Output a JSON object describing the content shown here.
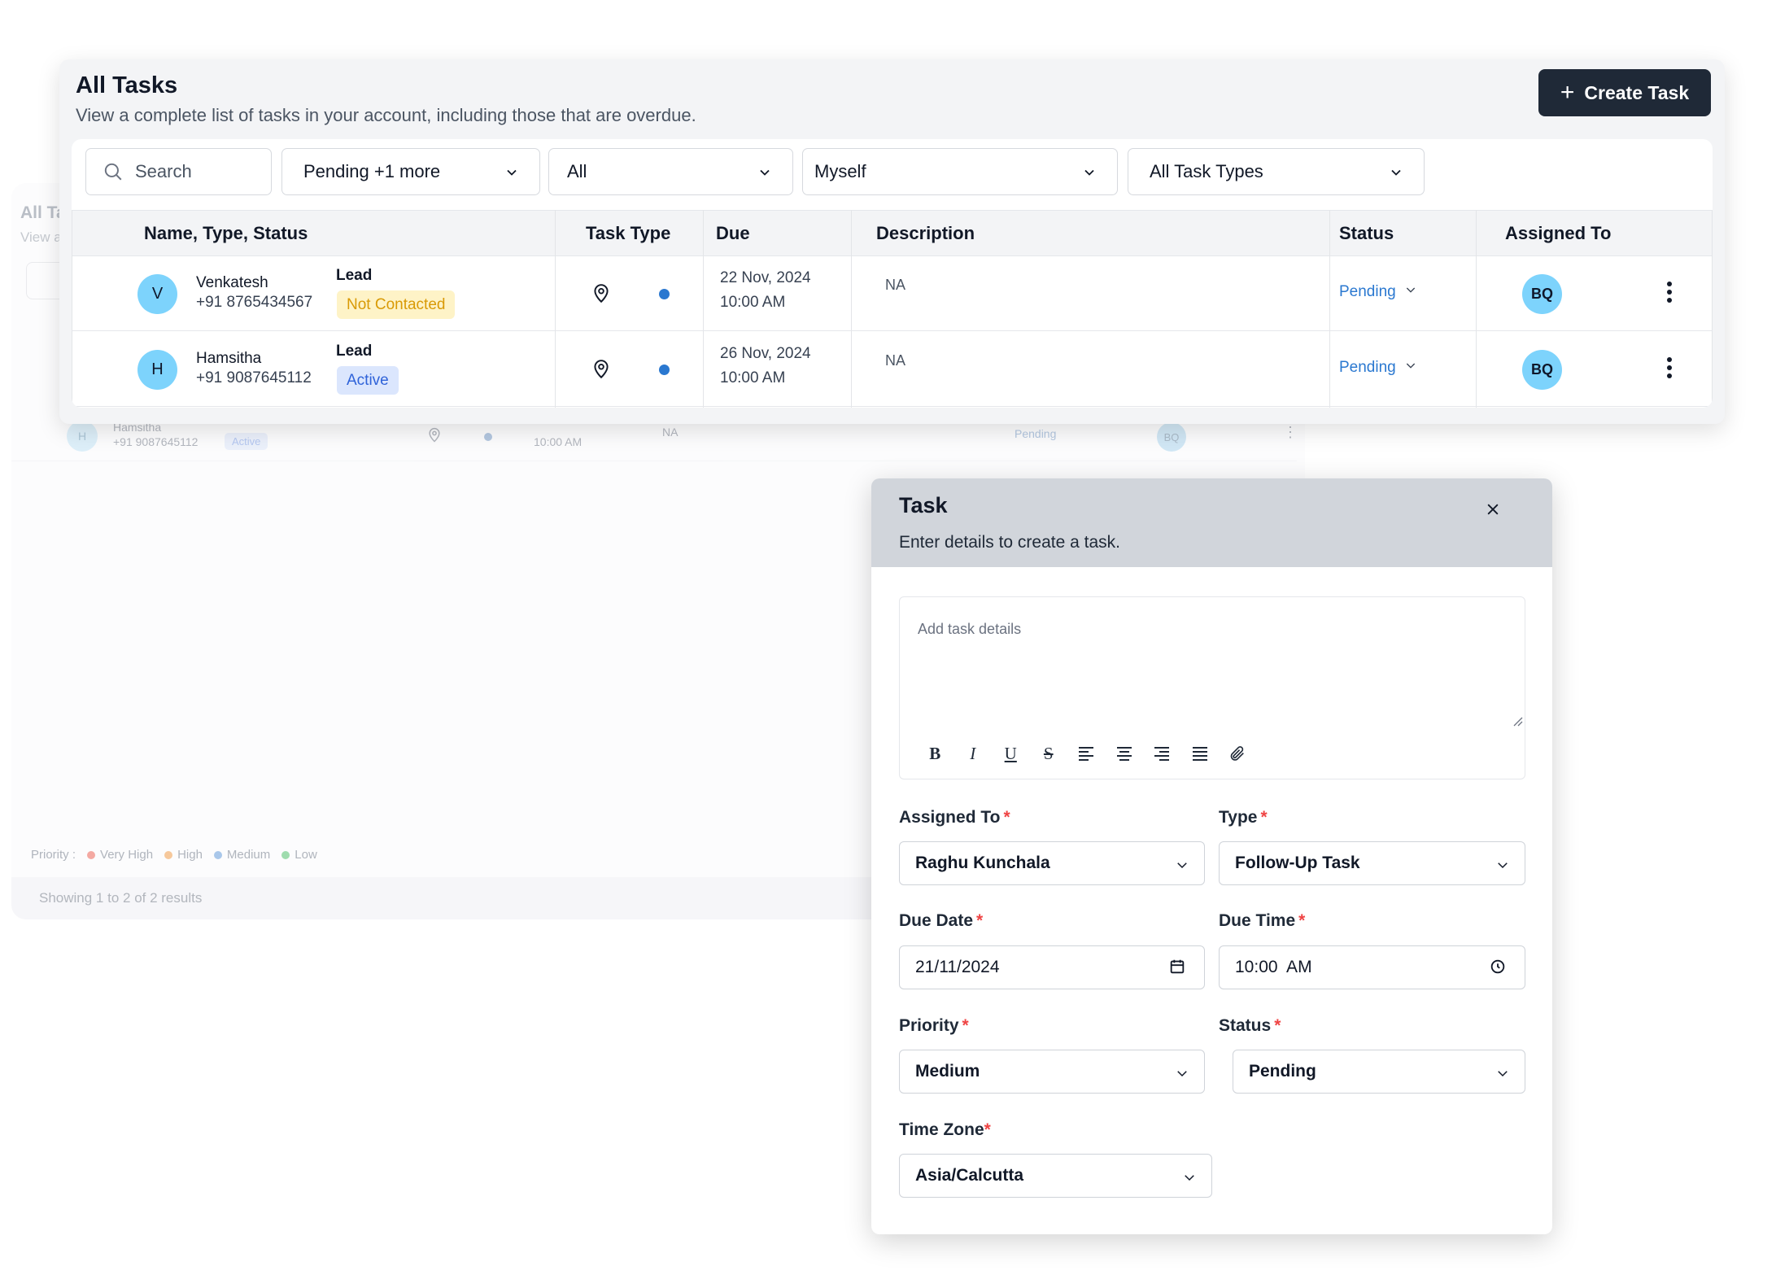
{
  "background": {
    "title": "All Ta",
    "subtitle": "View a",
    "row": {
      "avatar": "H",
      "name": "Hamsitha",
      "phone": "+91 9087645112",
      "badge": "Active",
      "due": "10:00 AM",
      "description": "NA",
      "status": "Pending",
      "assignee": "BQ"
    },
    "priority": {
      "label": "Priority :",
      "items": [
        {
          "label": "Very High",
          "color": "#f4a9a2"
        },
        {
          "label": "High",
          "color": "#f6c89b"
        },
        {
          "label": "Medium",
          "color": "#a9c7ea"
        },
        {
          "label": "Low",
          "color": "#9fdcae"
        }
      ]
    },
    "showing": "Showing 1 to 2 of 2 results"
  },
  "tasks": {
    "title": "All Tasks",
    "subtitle": "View a complete list of tasks in your account, including those that are overdue.",
    "create_label": "Create Task",
    "filters": {
      "search_placeholder": "Search",
      "status": "Pending +1 more",
      "scope": "All",
      "owner": "Myself",
      "task_types": "All Task Types"
    },
    "columns": [
      "Name, Type, Status",
      "Task Type",
      "Due",
      "Description",
      "Status",
      "Assigned To"
    ],
    "rows": [
      {
        "avatar": "V",
        "name": "Venkatesh",
        "phone": "+91 8765434567",
        "type": "Lead",
        "badge": "Not Contacted",
        "badge_color": "yellow",
        "due_date": "22 Nov, 2024",
        "due_time": "10:00 AM",
        "description": "NA",
        "status": "Pending",
        "assignee": "BQ"
      },
      {
        "avatar": "H",
        "name": "Hamsitha",
        "phone": "+91 9087645112",
        "type": "Lead",
        "badge": "Active",
        "badge_color": "blue",
        "due_date": "26 Nov, 2024",
        "due_time": "10:00 AM",
        "description": "NA",
        "status": "Pending",
        "assignee": "BQ"
      }
    ]
  },
  "modal": {
    "title": "Task",
    "subtitle": "Enter details to create a task.",
    "details_placeholder": "Add task details",
    "toolbar": [
      "B",
      "I",
      "U",
      "S"
    ],
    "fields": {
      "assigned_to": {
        "label": "Assigned To",
        "value": "Raghu Kunchala"
      },
      "type": {
        "label": "Type",
        "value": "Follow-Up Task"
      },
      "due_date": {
        "label": "Due Date",
        "value": "21/11/2024"
      },
      "due_time": {
        "label": "Due Time",
        "value": "10:00  AM"
      },
      "priority": {
        "label": "Priority",
        "value": "Medium"
      },
      "status": {
        "label": "Status",
        "value": "Pending"
      },
      "time_zone": {
        "label": "Time Zone",
        "value": "Asia/Calcutta"
      }
    },
    "required_mark": "*"
  }
}
